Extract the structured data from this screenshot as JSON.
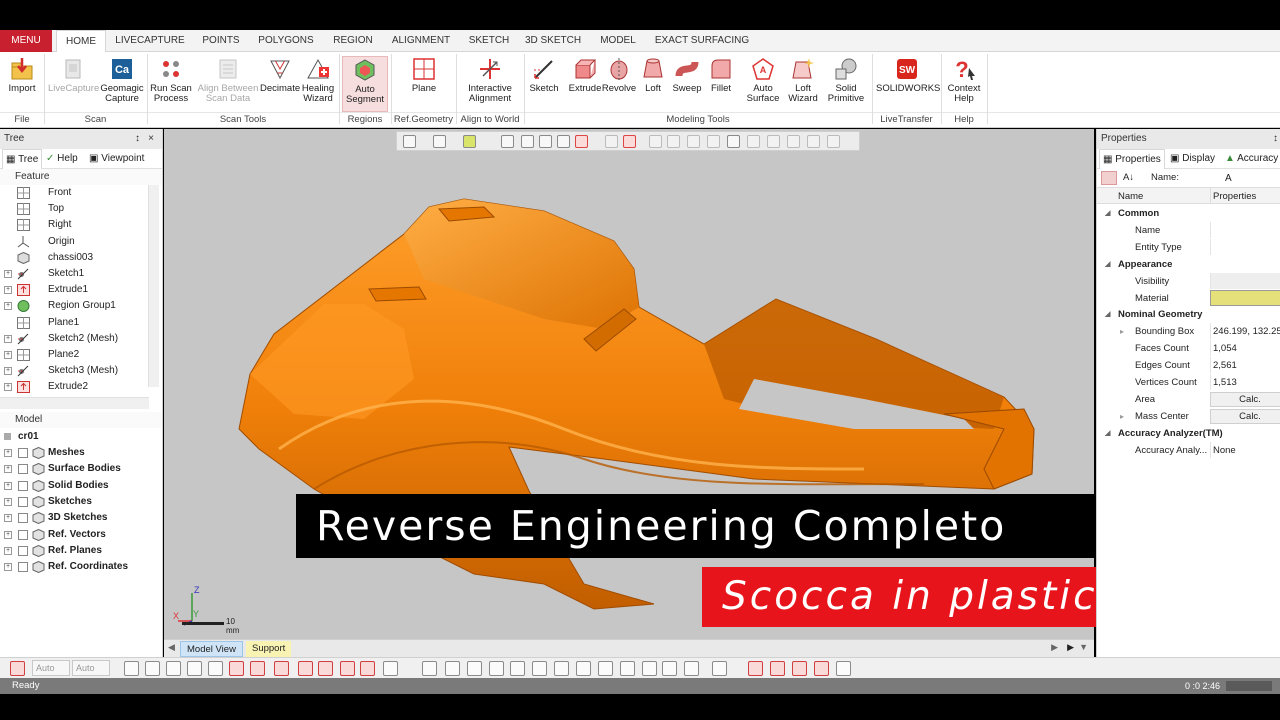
{
  "tabs": [
    {
      "label": "MENU",
      "id": "menu"
    },
    {
      "label": "HOME",
      "id": "home"
    },
    {
      "label": "LIVECAPTURE",
      "id": "livecapture"
    },
    {
      "label": "POINTS",
      "id": "points"
    },
    {
      "label": "POLYGONS",
      "id": "polygons"
    },
    {
      "label": "REGION",
      "id": "region"
    },
    {
      "label": "ALIGNMENT",
      "id": "alignment"
    },
    {
      "label": "SKETCH",
      "id": "sketch"
    },
    {
      "label": "3D SKETCH",
      "id": "3dsketch"
    },
    {
      "label": "MODEL",
      "id": "model"
    },
    {
      "label": "EXACT SURFACING",
      "id": "exactsurfacing"
    }
  ],
  "ribbon": {
    "buttons": [
      {
        "line1": "Import",
        "line2": "",
        "icon": "import-icon",
        "enabled": true
      },
      {
        "line1": "LiveCapture",
        "line2": "",
        "icon": "livecapture-icon",
        "enabled": false
      },
      {
        "line1": "Geomagic",
        "line2": "Capture",
        "icon": "geomagic-capture-icon",
        "enabled": true
      },
      {
        "line1": "Run Scan",
        "line2": "Process",
        "icon": "run-scan-icon",
        "enabled": true
      },
      {
        "line1": "Align Between",
        "line2": "Scan Data",
        "icon": "align-between-icon",
        "enabled": false
      },
      {
        "line1": "Decimate",
        "line2": "",
        "icon": "decimate-icon",
        "enabled": true
      },
      {
        "line1": "Healing",
        "line2": "Wizard",
        "icon": "healing-wizard-icon",
        "enabled": true
      },
      {
        "line1": "Auto",
        "line2": "Segment",
        "icon": "auto-segment-icon",
        "enabled": true
      },
      {
        "line1": "Plane",
        "line2": "",
        "icon": "plane-icon",
        "enabled": true
      },
      {
        "line1": "Interactive",
        "line2": "Alignment",
        "icon": "interactive-alignment-icon",
        "enabled": true
      },
      {
        "line1": "Sketch",
        "line2": "",
        "icon": "sketch-icon",
        "enabled": true
      },
      {
        "line1": "Extrude",
        "line2": "",
        "icon": "extrude-icon",
        "enabled": true
      },
      {
        "line1": "Revolve",
        "line2": "",
        "icon": "revolve-icon",
        "enabled": true
      },
      {
        "line1": "Loft",
        "line2": "",
        "icon": "loft-icon",
        "enabled": true
      },
      {
        "line1": "Sweep",
        "line2": "",
        "icon": "sweep-icon",
        "enabled": true
      },
      {
        "line1": "Fillet",
        "line2": "",
        "icon": "fillet-icon",
        "enabled": true
      },
      {
        "line1": "Auto",
        "line2": "Surface",
        "icon": "auto-surface-icon",
        "enabled": true
      },
      {
        "line1": "Loft",
        "line2": "Wizard",
        "icon": "loft-wizard-icon",
        "enabled": true
      },
      {
        "line1": "Solid",
        "line2": "Primitive",
        "icon": "solid-primitive-icon",
        "enabled": true
      },
      {
        "line1": "SOLIDWORKS",
        "line2": "",
        "icon": "solidworks-icon",
        "enabled": true
      },
      {
        "line1": "Context",
        "line2": "Help",
        "icon": "context-help-icon",
        "enabled": true
      }
    ],
    "groups": [
      "File",
      "Scan",
      "Scan Tools",
      "Regions",
      "Ref.Geometry",
      "Align to World",
      "Modeling Tools",
      "LiveTransfer",
      "Help"
    ]
  },
  "tree_panel": {
    "title": "Tree",
    "pin": "↕",
    "close": "×",
    "tabs": [
      "Tree",
      "Help",
      "Viewpoint"
    ],
    "feature_header": "Feature",
    "features": [
      {
        "label": "Front",
        "icon": "plane-icon",
        "expandable": false,
        "dot": false
      },
      {
        "label": "Top",
        "icon": "plane-icon",
        "expandable": false,
        "dot": false
      },
      {
        "label": "Right",
        "icon": "plane-icon",
        "expandable": false,
        "dot": false
      },
      {
        "label": "Origin",
        "icon": "origin-icon",
        "expandable": false,
        "dot": false
      },
      {
        "label": "chassi003",
        "icon": "mesh-icon",
        "expandable": false,
        "dot": true
      },
      {
        "label": "Sketch1",
        "icon": "sketch-icon",
        "expandable": true,
        "dot": true
      },
      {
        "label": "Extrude1",
        "icon": "extrude-icon",
        "expandable": true,
        "dot": true
      },
      {
        "label": "Region Group1",
        "icon": "region-group-icon",
        "expandable": true,
        "dot": true
      },
      {
        "label": "Plane1",
        "icon": "plane-icon",
        "expandable": false,
        "dot": true
      },
      {
        "label": "Sketch2 (Mesh)",
        "icon": "sketch-icon",
        "expandable": true,
        "dot": true
      },
      {
        "label": "Plane2",
        "icon": "plane-icon",
        "expandable": true,
        "dot": true
      },
      {
        "label": "Sketch3 (Mesh)",
        "icon": "sketch-icon",
        "expandable": true,
        "dot": true
      },
      {
        "label": "Extrude2",
        "icon": "extrude-icon",
        "expandable": true,
        "dot": true
      }
    ],
    "model_header": "Model",
    "model_root": "cr01",
    "model_items": [
      {
        "label": "Meshes",
        "icon": "meshes-icon"
      },
      {
        "label": "Surface Bodies",
        "icon": "surface-bodies-icon"
      },
      {
        "label": "Solid Bodies",
        "icon": "solid-bodies-icon"
      },
      {
        "label": "Sketches",
        "icon": "sketches-icon"
      },
      {
        "label": "3D Sketches",
        "icon": "3d-sketches-icon"
      },
      {
        "label": "Ref. Vectors",
        "icon": "ref-vectors-icon"
      },
      {
        "label": "Ref. Planes",
        "icon": "ref-planes-icon"
      },
      {
        "label": "Ref. Coordinates",
        "icon": "ref-coordinates-icon"
      }
    ]
  },
  "viewport": {
    "scale_label": "10 mm",
    "axis_labels": [
      "Z",
      "X",
      "Y"
    ],
    "view_tabs": [
      "Model View",
      "Support"
    ]
  },
  "overlay": {
    "title": "Reverse Engineering Completo",
    "subtitle": "Scocca in plastica",
    "title_bg": "#000000",
    "subtitle_bg": "#e8141b"
  },
  "properties": {
    "title": "Properties",
    "tabs": [
      "Properties",
      "Display",
      "Accuracy A"
    ],
    "name_label": "Name:",
    "columns": [
      "Name",
      "Properties"
    ],
    "rows": [
      {
        "type": "cat",
        "name": "Common"
      },
      {
        "type": "row",
        "name": "Name",
        "value": ""
      },
      {
        "type": "row",
        "name": "Entity Type",
        "value": ""
      },
      {
        "type": "cat",
        "name": "Appearance"
      },
      {
        "type": "row",
        "name": "Visibility",
        "value": ""
      },
      {
        "type": "row",
        "name": "Material",
        "value": ""
      },
      {
        "type": "cat",
        "name": "Nominal Geometry"
      },
      {
        "type": "row",
        "name": "Bounding Box",
        "value": "246.199, 132.25,"
      },
      {
        "type": "row",
        "name": "Faces Count",
        "value": "1,054"
      },
      {
        "type": "row",
        "name": "Edges Count",
        "value": "2,561"
      },
      {
        "type": "row",
        "name": "Vertices Count",
        "value": "1,513"
      },
      {
        "type": "calc",
        "name": "Area",
        "value": "Calc."
      },
      {
        "type": "calc",
        "name": "Mass Center",
        "value": "Calc."
      },
      {
        "type": "cat",
        "name": "Accuracy Analyzer(TM)"
      },
      {
        "type": "row",
        "name": "Accuracy Analy...",
        "value": "None"
      }
    ],
    "material_color": "#e6e07a"
  },
  "bottom_toolbar": {
    "select1": "Auto",
    "select2": "Auto"
  },
  "status": {
    "text": "Ready",
    "coords": "0 :0 2:46"
  },
  "colors": {
    "menu": "#c8202f",
    "part": "#f28a0c",
    "viewport_bg": "#c6c6c6"
  }
}
